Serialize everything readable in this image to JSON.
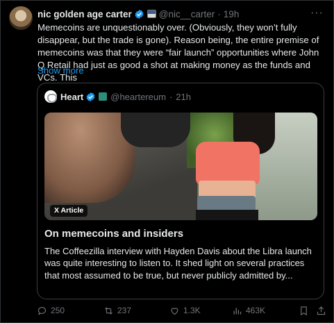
{
  "post": {
    "author_name": "nic golden age carter",
    "author_handle": "@nic__carter",
    "time": "19h",
    "more_label": "···",
    "text": "Memecoins are unquestionably over. (Obviously, they won’t fully disappear, but the trade is gone). Reason being, the entire premise of memecoins was that they were “fair launch” opportunities where John Q Retail had just as good a shot at making money as the funds and VCs. This",
    "show_more": "Show more"
  },
  "quote": {
    "author_name": "Heart",
    "author_handle": "@heartereum",
    "time": "21h",
    "media_label": "X Article",
    "title": "On memecoins and insiders",
    "description": "The Coffeezilla interview with Hayden Davis about the Libra launch was quite interesting to listen to. It shed light on several practices that most assumed to be true, but never publicly admitted by..."
  },
  "actions": {
    "replies": "250",
    "reposts": "237",
    "likes": "1.3K",
    "views": "463K"
  },
  "icons": {
    "verified": "verified-badge-icon",
    "reply": "reply-icon",
    "repost": "repost-icon",
    "like": "heart-icon",
    "views": "views-icon",
    "bookmark": "bookmark-icon",
    "share": "share-icon"
  },
  "colors": {
    "background": "#000000",
    "text": "#e7e9ea",
    "muted": "#71767b",
    "link": "#1d9bf0",
    "verified": "#1d9bf0",
    "border": "#2f3336"
  }
}
